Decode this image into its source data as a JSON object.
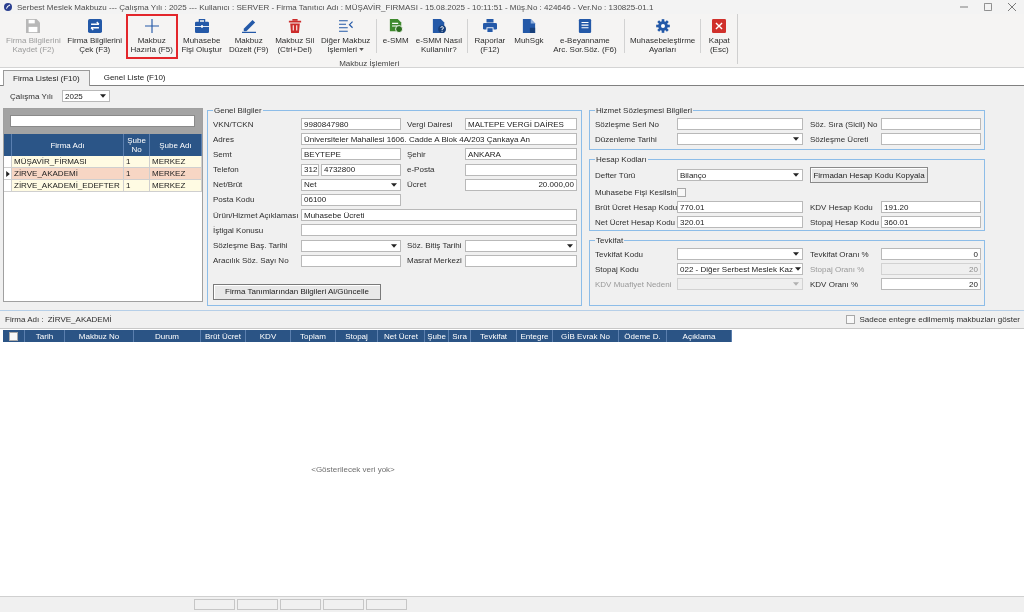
{
  "window": {
    "title": "Serbest Meslek Makbuzu --- Çalışma Yılı : 2025 --- Kullanıcı : SERVER - Firma Tanıtıcı Adı : MÜŞAVİR_FIRMASI - 15.08.2025 - 10:11:51 - Müş.No : 424646 - Ver.No : 130825-01.1"
  },
  "ribbon": {
    "group_label": "Makbuz İşlemleri",
    "sections": [
      {
        "buttons": [
          {
            "lines": [
              "Firma Bilgilerini",
              "Kaydet (F2)"
            ],
            "disabled": true,
            "highlighted": false,
            "has_menu": false
          },
          {
            "lines": [
              "Firma Bilgilerini",
              "Çek (F3)"
            ],
            "disabled": false,
            "highlighted": false,
            "has_menu": false
          },
          {
            "lines": [
              "Makbuz",
              "Hazırla (F5)"
            ],
            "disabled": false,
            "highlighted": true,
            "has_menu": false
          },
          {
            "lines": [
              "Muhasebe",
              "Fişi Oluştur"
            ],
            "disabled": false,
            "highlighted": false,
            "has_menu": false
          },
          {
            "lines": [
              "Makbuz",
              "Düzelt (F9)"
            ],
            "disabled": false,
            "highlighted": false,
            "has_menu": false
          },
          {
            "lines": [
              "Makbuz Sil",
              "(Ctrl+Del)"
            ],
            "disabled": false,
            "highlighted": false,
            "has_menu": false
          },
          {
            "lines": [
              "Diğer Makbuz",
              "İşlemleri"
            ],
            "disabled": false,
            "highlighted": false,
            "has_menu": true
          }
        ]
      },
      {
        "buttons": [
          {
            "lines": [
              "e-SMM"
            ],
            "disabled": false,
            "highlighted": false,
            "has_menu": false
          },
          {
            "lines": [
              "e-SMM Nasıl",
              "Kullanılır?"
            ],
            "disabled": false,
            "highlighted": false,
            "has_menu": false
          }
        ]
      },
      {
        "buttons": [
          {
            "lines": [
              "Raporlar",
              "(F12)"
            ],
            "disabled": false,
            "highlighted": false,
            "has_menu": false
          },
          {
            "lines": [
              "MuhSgk"
            ],
            "disabled": false,
            "highlighted": false,
            "has_menu": false
          },
          {
            "lines": [
              "e-Beyanname",
              "Arc. Sor.Söz. (F6)"
            ],
            "disabled": false,
            "highlighted": false,
            "has_menu": false
          }
        ]
      },
      {
        "buttons": [
          {
            "lines": [
              "Muhasebeleştirme",
              "Ayarları"
            ],
            "disabled": false,
            "highlighted": false,
            "has_menu": false
          }
        ]
      },
      {
        "buttons": [
          {
            "lines": [
              "Kapat",
              "(Esc)"
            ],
            "disabled": false,
            "highlighted": false,
            "has_menu": false
          }
        ]
      }
    ]
  },
  "tabs": [
    {
      "label": "Firma Listesi (F10)",
      "selected": true
    },
    {
      "label": "Genel Liste (F10)",
      "selected": false
    }
  ],
  "year_filter": {
    "label": "Çalışma Yılı",
    "value": "2025"
  },
  "firm_list": {
    "columns": [
      "Firma Adı",
      "Şube No",
      "Şube Adı"
    ],
    "rows": [
      {
        "cells": [
          "MÜŞAVİR_FİRMASI",
          "1",
          "MERKEZ"
        ],
        "selected": false
      },
      {
        "cells": [
          "ZİRVE_AKADEMİ",
          "1",
          "MERKEZ"
        ],
        "selected": true
      },
      {
        "cells": [
          "ZİRVE_AKADEMİ_EDEFTER",
          "1",
          "MERKEZ"
        ],
        "selected": false
      }
    ]
  },
  "general_info": {
    "title": "Genel Bilgiler",
    "rows": [
      {
        "fields": [
          {
            "label": "VKN/TCKN",
            "kind": "text",
            "value": "9980847980",
            "disabled": false
          },
          {
            "label": "Vergi Dairesi",
            "kind": "text",
            "value": "MALTEPE VERGİ DAİRES",
            "disabled": false
          }
        ]
      },
      {
        "fields": [
          {
            "label": "Adres",
            "kind": "wide",
            "value": "Üniversiteler Mahallesi 1606. Cadde A Blok 4A/203 Çankaya An",
            "disabled": false
          }
        ]
      },
      {
        "fields": [
          {
            "label": "Semt",
            "kind": "text",
            "value": "BEYTEPE",
            "disabled": false
          },
          {
            "label": "Şehir",
            "kind": "text",
            "value": "ANKARA",
            "disabled": false
          }
        ]
      },
      {
        "fields": [
          {
            "label": "Telefon",
            "kind": "phone",
            "area_code": "312",
            "value": "4732800",
            "disabled": false
          },
          {
            "label": "e-Posta",
            "kind": "text",
            "disabled": false
          }
        ]
      },
      {
        "fields": [
          {
            "label": "Net/Brüt",
            "kind": "select",
            "value": "Net",
            "disabled": false
          },
          {
            "label": "Ücret",
            "kind": "number",
            "value": "20.000,00",
            "disabled": false
          }
        ]
      },
      {
        "fields": [
          {
            "label": "Posta Kodu",
            "kind": "text",
            "value": "06100",
            "disabled": false
          }
        ]
      },
      {
        "fields": [
          {
            "label": "Ürün/Hizmet Açıklaması",
            "kind": "wide",
            "value": "Muhasebe Ücreti",
            "disabled": false
          }
        ]
      },
      {
        "fields": [
          {
            "label": "İştigal Konusu",
            "kind": "wide",
            "disabled": false
          }
        ]
      },
      {
        "fields": [
          {
            "label": "Sözleşme Baş. Tarihi",
            "kind": "select",
            "disabled": false
          },
          {
            "label": "Söz. Bitiş Tarihi",
            "kind": "select",
            "disabled": false
          }
        ]
      },
      {
        "fields": [
          {
            "label": "Aracılık Söz. Sayı No",
            "kind": "text",
            "disabled": false
          },
          {
            "label": "Masraf Merkezi",
            "kind": "text",
            "disabled": false
          }
        ]
      }
    ],
    "action": "Firma Tanımlarından Bilgileri Al/Güncelle"
  },
  "service_contract": {
    "title": "Hizmet Sözleşmesi Bilgileri",
    "rows": [
      {
        "fields": [
          {
            "label": "Sözleşme Seri No",
            "kind": "text",
            "disabled": false
          },
          {
            "label": "Söz. Sıra (Sicil) No",
            "kind": "text",
            "disabled": false
          }
        ]
      },
      {
        "fields": [
          {
            "label": "Düzenleme Tarihi",
            "kind": "select",
            "disabled": false
          },
          {
            "label": "Sözleşme Ücreti",
            "kind": "text",
            "disabled": false
          }
        ]
      }
    ]
  },
  "account_codes": {
    "title": "Hesap Kodları",
    "rows": [
      {
        "fields": [
          {
            "label": "Defter Türü",
            "kind": "select",
            "value": "Bilanço",
            "disabled": false
          },
          {
            "label": "Firmadan Hesap Kodu Kopyala",
            "kind": "button",
            "disabled": false
          }
        ]
      },
      {
        "fields": [
          {
            "label": "Muhasebe Fişi Kesilsin",
            "kind": "checkbox",
            "checked": false,
            "disabled": false
          }
        ]
      },
      {
        "fields": [
          {
            "label": "Brüt Ücret Hesap Kodu",
            "kind": "text",
            "value": "770.01",
            "disabled": false
          },
          {
            "label": "KDV Hesap Kodu",
            "kind": "text",
            "value": "191.20",
            "disabled": false
          }
        ]
      },
      {
        "fields": [
          {
            "label": "Net Ücret Hesap Kodu",
            "kind": "text",
            "value": "320.01",
            "disabled": false
          },
          {
            "label": "Stopaj Hesap Kodu",
            "kind": "text",
            "value": "360.01",
            "disabled": false
          }
        ]
      }
    ]
  },
  "withholding": {
    "title": "Tevkifat",
    "rows": [
      {
        "fields": [
          {
            "label": "Tevkifat Kodu",
            "kind": "select",
            "disabled": false
          },
          {
            "label": "Tevkifat Oranı %",
            "kind": "number",
            "value": "0",
            "disabled": false
          }
        ]
      },
      {
        "fields": [
          {
            "label": "Stopaj Kodu",
            "kind": "select",
            "value": "022 - Diğer Serbest Meslek Kaz",
            "disabled": false
          },
          {
            "label": "Stopaj Oranı %",
            "kind": "number",
            "value": "20",
            "disabled": true
          }
        ]
      },
      {
        "fields": [
          {
            "label": "KDV Muafiyet Nedeni",
            "kind": "select",
            "disabled": true
          },
          {
            "label": "KDV Oranı %",
            "kind": "number",
            "value": "20",
            "disabled": false
          }
        ]
      }
    ]
  },
  "receipts": {
    "firm_label": "Firma Adı :",
    "firm_name": "ZİRVE_AKADEMİ",
    "filter": {
      "label": "Sadece entegre edilmemiş makbuzları göster",
      "checked": false
    },
    "select_all": {
      "checked": false
    },
    "columns": [
      "Tarih",
      "Makbuz No",
      "Durum",
      "Brüt Ücret",
      "KDV",
      "Toplam",
      "Stopaj",
      "Net Ücret",
      "Şube",
      "Sıra",
      "Tevkifat",
      "Entegre",
      "GİB Evrak No",
      "Ödeme D.",
      "Açıklama"
    ],
    "empty_text": "<Gösterilecek veri yok>"
  }
}
